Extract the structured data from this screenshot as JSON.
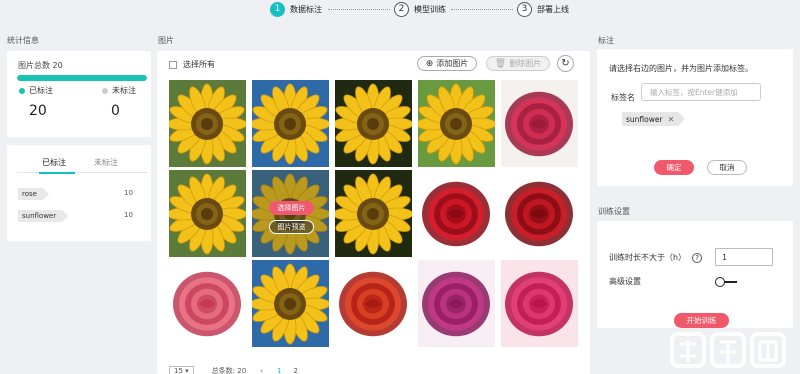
{
  "stepper": {
    "steps": [
      {
        "num": "1",
        "label": "数据标注"
      },
      {
        "num": "2",
        "label": "模型训练"
      },
      {
        "num": "3",
        "label": "部署上线"
      }
    ]
  },
  "stats": {
    "section_title": "统计信息",
    "total_label": "图片总数 20",
    "progress_fraction": 1.0,
    "labeled_label": "已标注",
    "unlabeled_label": "未标注",
    "labeled_count": "20",
    "unlabeled_count": "0",
    "colors": {
      "labeled": "#18c3b4",
      "unlabeled": "#cccccc"
    }
  },
  "tag_tabs": {
    "active": "已标注",
    "inactive": "未标注",
    "items": [
      {
        "name": "rose",
        "count": "10"
      },
      {
        "name": "sunflower",
        "count": "10"
      }
    ]
  },
  "images": {
    "section_title": "图片",
    "select_all": "选择所有",
    "add_button": "添加图片",
    "delete_button": "删除图片",
    "hover_select": "选择图片",
    "hover_preview": "图片预览",
    "tiles": [
      "sunflower",
      "sunflower",
      "sunflower",
      "sunflower",
      "rose",
      "sunflower",
      "sunflower",
      "sunflower",
      "rose",
      "rose",
      "rose",
      "sunflower",
      "rose",
      "rose",
      "rose"
    ],
    "pager": {
      "page_size": "15",
      "total_label": "总条数: 20",
      "pages": [
        "1",
        "2"
      ]
    }
  },
  "annotate": {
    "section_title": "标注",
    "hint": "请选择右边的图片，并为图片添加标签。",
    "tag_label": "标签名",
    "tag_placeholder": "输入标签，按Enter键添加",
    "chip": "sunflower",
    "ok_button": "确定",
    "cancel_button": "取消"
  },
  "training": {
    "section_title": "训练设置",
    "duration_label": "训练时长不大于（h）",
    "duration_value": "1",
    "advanced_label": "高级设置",
    "start_button": "开始训练"
  },
  "watermark": "智东西",
  "accent": "#14c0c4",
  "primary_button_color": "#f0596a"
}
